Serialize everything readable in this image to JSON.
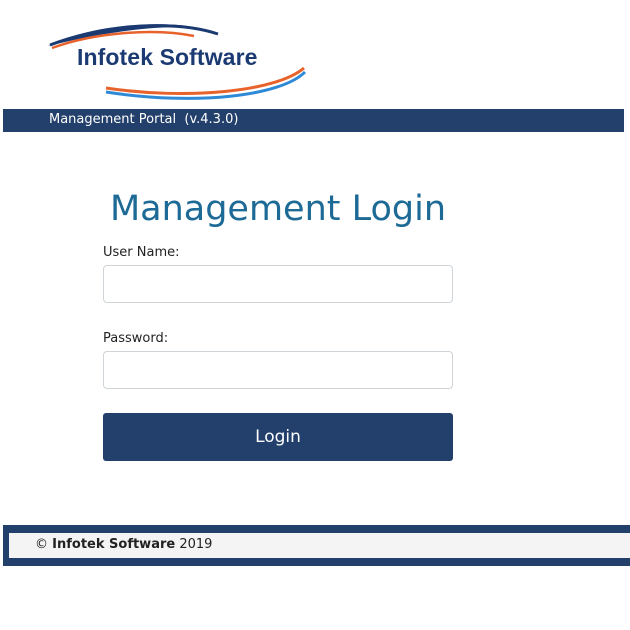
{
  "logo": {
    "text": "Infotek Software",
    "colors": {
      "text": "#1b3a72",
      "swoosh_blue": "#1b3a72",
      "swoosh_orange": "#e8632b",
      "swoosh_light_blue": "#2e8ad6"
    }
  },
  "header": {
    "title": "Management Portal  (v.4.3.0)"
  },
  "login": {
    "heading": "Management Login",
    "username_label": "User Name:",
    "username_value": "",
    "password_label": "Password:",
    "password_value": "",
    "button_label": "Login"
  },
  "footer": {
    "copyright_symbol": "©",
    "company": "Infotek Software",
    "year": "2019"
  },
  "colors": {
    "primary": "#22406b",
    "heading": "#1d6a96",
    "footer_bg": "#f4f4f4"
  }
}
